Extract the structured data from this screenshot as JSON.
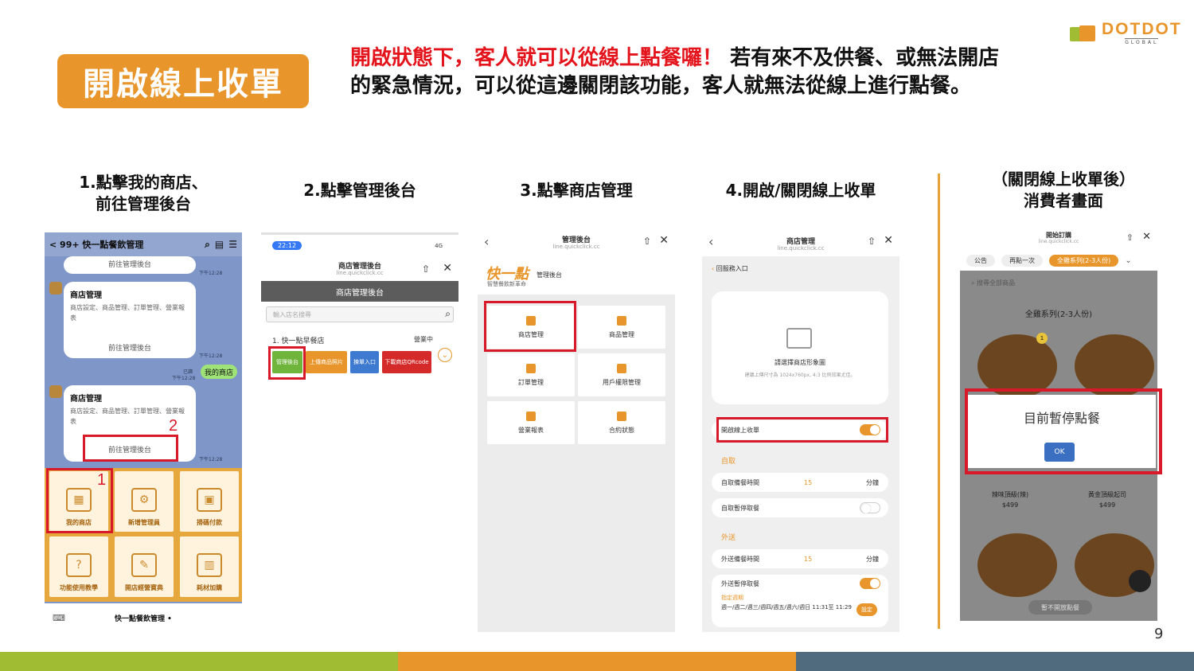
{
  "header": {
    "title": "開啟線上收單",
    "intro_red": "開啟狀態下，客人就可以從線上點餐囉！",
    "intro_black": " 若有來不及供餐、或無法開店的緊急情況，可以從這邊關閉該功能，客人就無法從線上進行點餐。"
  },
  "logo": {
    "text": "DOTDOT",
    "sub": "GLOBAL"
  },
  "steps": {
    "s1a": "1.點擊我的商店、",
    "s1b": "前往管理後台",
    "s2": "2.點擊管理後台",
    "s3": "3.點擊商店管理",
    "s4": "4.開啟/關閉線上收單",
    "s5a": "（關閉線上收單後）",
    "s5b": "消費者畫面"
  },
  "shot1": {
    "topbar": "< 99+  快一點餐飲管理",
    "link": "前往管理後台",
    "bubble_title": "商店管理",
    "bubble_desc": "商店設定、商品管理、訂單管理、營業報表",
    "my_store_msg": "我的商店",
    "ts1": "下午12:28",
    "read": "已讀",
    "marker1": "1",
    "marker2": "2",
    "tiles": [
      "我的商店",
      "新增管理員",
      "掃碼付款",
      "功能使用教學",
      "開店經營寶典",
      "耗材加購"
    ],
    "footer": "快一點餐飲管理 •"
  },
  "shot2": {
    "time": "22:12",
    "signal": "4G",
    "title": "商店管理後台",
    "url": "line.quickclick.cc",
    "header": "商店管理後台",
    "search_placeholder": "輸入店名搜尋",
    "store": "1. 快一點早餐店",
    "status": "營業中",
    "buttons": [
      "管理後台",
      "上傳商品照片",
      "揀單入口",
      "下載商店QRcode"
    ]
  },
  "shot3": {
    "title": "管理後台",
    "url": "line.quickclick.cc",
    "brand": "快一點",
    "brand_sub": "智慧餐飲新革命",
    "brand_right": "管理後台",
    "cells": [
      "商店管理",
      "商品管理",
      "訂單管理",
      "用戶權限管理",
      "營業報表",
      "合約狀態"
    ]
  },
  "shot4": {
    "title": "商店管理",
    "url": "line.quickclick.cc",
    "back": "回服務入口",
    "upload_title": "請選擇商店形象圖",
    "upload_hint": "建議上傳尺寸為 1024x760px, 4:3 比例效果尤佳。",
    "online_order": "開啟線上收單",
    "pickup": "自取",
    "pickup_time": "自取備餐時間",
    "pickup_val": "15",
    "unit": "分鐘",
    "pickup_pause": "自取暫停取餐",
    "delivery": "外送",
    "delivery_time": "外送備餐時間",
    "delivery_val": "15",
    "delivery_pause": "外送暫停取餐",
    "schedule_label": "指定週期",
    "schedule": "週一/週二/週三/週四/週五/週六/週日 11:31至 11:29",
    "set_btn": "設定"
  },
  "shot5": {
    "title": "開始訂購",
    "url": "line.quickclick.cc",
    "tabs": [
      "公告",
      "再點一次",
      "全雞系列(2-3人份)"
    ],
    "search": "搜尋全部商品",
    "category": "全雞系列(2-3人份)",
    "badge": "1",
    "items": [
      "辣味頂級(辣)",
      "黃金頂級起司"
    ],
    "prices": [
      "$499",
      "$499"
    ],
    "modal_title": "目前暫停點餐",
    "ok": "OK",
    "bottom": "暫不開放點餐"
  },
  "page_number": "9",
  "colors": {
    "orange": "#e8962b",
    "red": "#e3141b",
    "green": "#9fbc33",
    "teal": "#4f6b7d"
  }
}
